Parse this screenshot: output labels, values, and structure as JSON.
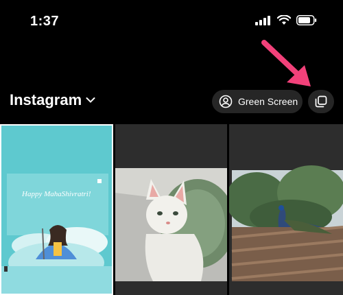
{
  "status": {
    "time": "1:37"
  },
  "header": {
    "title": "Instagram",
    "green_screen_label": "Green Screen"
  },
  "colors": {
    "accent_arrow": "#f2417a",
    "pill_bg": "#262626",
    "tile_teal": "#5ec9cf"
  },
  "thumbnails": [
    {
      "caption": "Happy MahaShivratri!",
      "selected": true
    },
    {
      "caption": "",
      "selected": false
    },
    {
      "caption": "",
      "selected": false
    }
  ]
}
